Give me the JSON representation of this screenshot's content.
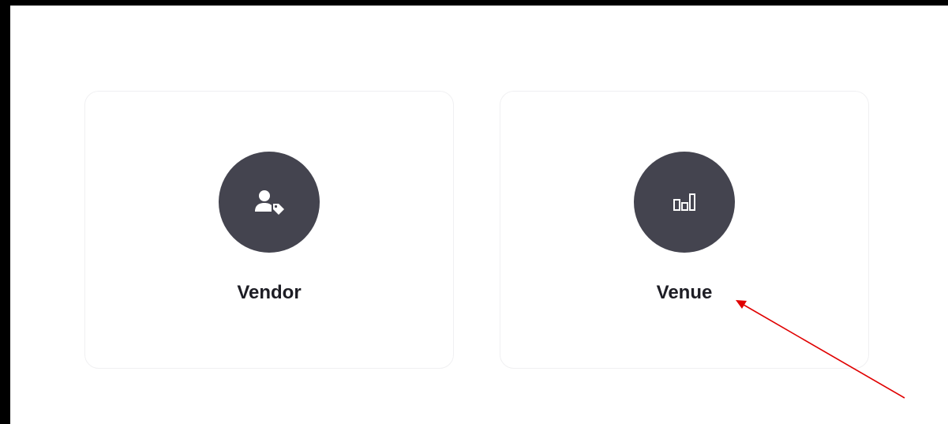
{
  "cards": [
    {
      "label": "Vendor",
      "icon": "user-tag-icon"
    },
    {
      "label": "Venue",
      "icon": "bar-chart-icon"
    }
  ],
  "colors": {
    "icon_circle": "#44444f",
    "icon_glyph": "#ffffff",
    "label_text": "#1d1d24",
    "card_border": "#f0f0f2",
    "frame": "#000000",
    "annotation_arrow": "#e00000"
  }
}
